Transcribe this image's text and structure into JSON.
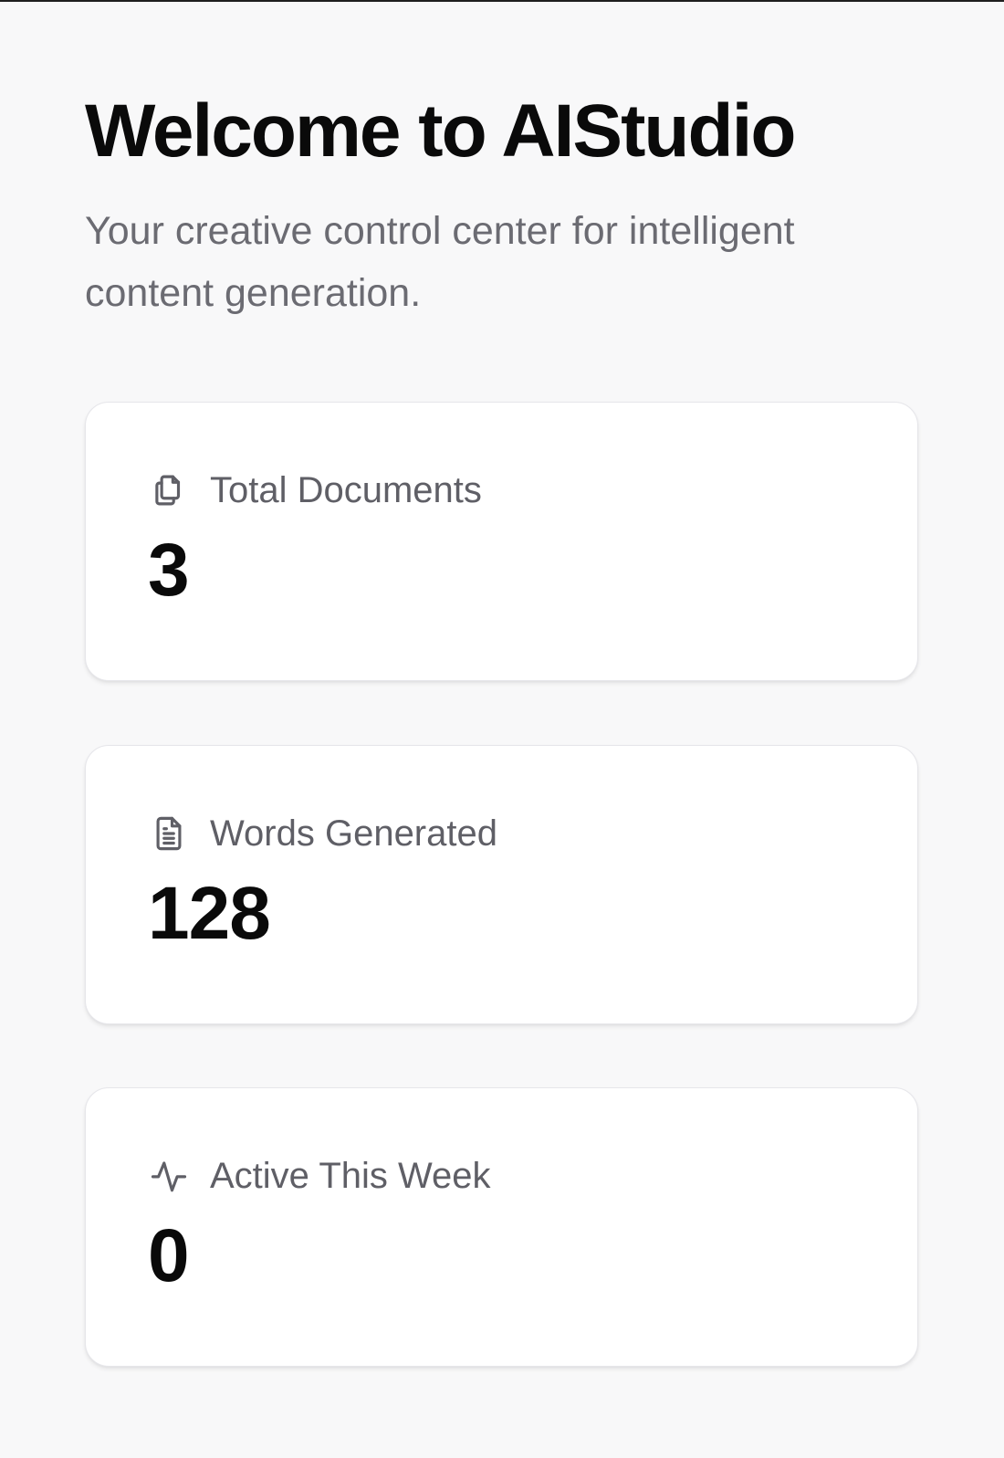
{
  "header": {
    "title": "Welcome to AIStudio",
    "subtitle": "Your creative control center for intelligent content generation."
  },
  "stats": [
    {
      "label": "Total Documents",
      "value": "3",
      "icon": "documents-icon"
    },
    {
      "label": "Words Generated",
      "value": "128",
      "icon": "file-text-icon"
    },
    {
      "label": "Active This Week",
      "value": "0",
      "icon": "activity-icon"
    }
  ],
  "colors": {
    "background": "#f8f8f9",
    "card": "#ffffff",
    "title": "#0a0a0a",
    "muted_text": "#6b6b72"
  }
}
